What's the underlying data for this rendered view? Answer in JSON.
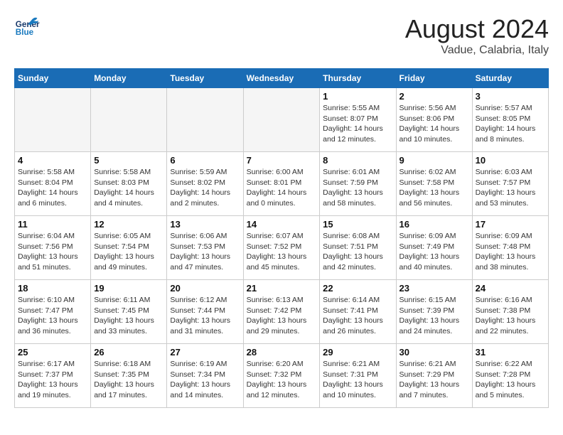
{
  "header": {
    "logo_general": "General",
    "logo_blue": "Blue",
    "month": "August 2024",
    "location": "Vadue, Calabria, Italy"
  },
  "days_of_week": [
    "Sunday",
    "Monday",
    "Tuesday",
    "Wednesday",
    "Thursday",
    "Friday",
    "Saturday"
  ],
  "weeks": [
    [
      {
        "day": "",
        "info": "",
        "empty": true
      },
      {
        "day": "",
        "info": "",
        "empty": true
      },
      {
        "day": "",
        "info": "",
        "empty": true
      },
      {
        "day": "",
        "info": "",
        "empty": true
      },
      {
        "day": "1",
        "info": "Sunrise: 5:55 AM\nSunset: 8:07 PM\nDaylight: 14 hours\nand 12 minutes."
      },
      {
        "day": "2",
        "info": "Sunrise: 5:56 AM\nSunset: 8:06 PM\nDaylight: 14 hours\nand 10 minutes."
      },
      {
        "day": "3",
        "info": "Sunrise: 5:57 AM\nSunset: 8:05 PM\nDaylight: 14 hours\nand 8 minutes."
      }
    ],
    [
      {
        "day": "4",
        "info": "Sunrise: 5:58 AM\nSunset: 8:04 PM\nDaylight: 14 hours\nand 6 minutes."
      },
      {
        "day": "5",
        "info": "Sunrise: 5:58 AM\nSunset: 8:03 PM\nDaylight: 14 hours\nand 4 minutes."
      },
      {
        "day": "6",
        "info": "Sunrise: 5:59 AM\nSunset: 8:02 PM\nDaylight: 14 hours\nand 2 minutes."
      },
      {
        "day": "7",
        "info": "Sunrise: 6:00 AM\nSunset: 8:01 PM\nDaylight: 14 hours\nand 0 minutes."
      },
      {
        "day": "8",
        "info": "Sunrise: 6:01 AM\nSunset: 7:59 PM\nDaylight: 13 hours\nand 58 minutes."
      },
      {
        "day": "9",
        "info": "Sunrise: 6:02 AM\nSunset: 7:58 PM\nDaylight: 13 hours\nand 56 minutes."
      },
      {
        "day": "10",
        "info": "Sunrise: 6:03 AM\nSunset: 7:57 PM\nDaylight: 13 hours\nand 53 minutes."
      }
    ],
    [
      {
        "day": "11",
        "info": "Sunrise: 6:04 AM\nSunset: 7:56 PM\nDaylight: 13 hours\nand 51 minutes."
      },
      {
        "day": "12",
        "info": "Sunrise: 6:05 AM\nSunset: 7:54 PM\nDaylight: 13 hours\nand 49 minutes."
      },
      {
        "day": "13",
        "info": "Sunrise: 6:06 AM\nSunset: 7:53 PM\nDaylight: 13 hours\nand 47 minutes."
      },
      {
        "day": "14",
        "info": "Sunrise: 6:07 AM\nSunset: 7:52 PM\nDaylight: 13 hours\nand 45 minutes."
      },
      {
        "day": "15",
        "info": "Sunrise: 6:08 AM\nSunset: 7:51 PM\nDaylight: 13 hours\nand 42 minutes."
      },
      {
        "day": "16",
        "info": "Sunrise: 6:09 AM\nSunset: 7:49 PM\nDaylight: 13 hours\nand 40 minutes."
      },
      {
        "day": "17",
        "info": "Sunrise: 6:09 AM\nSunset: 7:48 PM\nDaylight: 13 hours\nand 38 minutes."
      }
    ],
    [
      {
        "day": "18",
        "info": "Sunrise: 6:10 AM\nSunset: 7:47 PM\nDaylight: 13 hours\nand 36 minutes."
      },
      {
        "day": "19",
        "info": "Sunrise: 6:11 AM\nSunset: 7:45 PM\nDaylight: 13 hours\nand 33 minutes."
      },
      {
        "day": "20",
        "info": "Sunrise: 6:12 AM\nSunset: 7:44 PM\nDaylight: 13 hours\nand 31 minutes."
      },
      {
        "day": "21",
        "info": "Sunrise: 6:13 AM\nSunset: 7:42 PM\nDaylight: 13 hours\nand 29 minutes."
      },
      {
        "day": "22",
        "info": "Sunrise: 6:14 AM\nSunset: 7:41 PM\nDaylight: 13 hours\nand 26 minutes."
      },
      {
        "day": "23",
        "info": "Sunrise: 6:15 AM\nSunset: 7:39 PM\nDaylight: 13 hours\nand 24 minutes."
      },
      {
        "day": "24",
        "info": "Sunrise: 6:16 AM\nSunset: 7:38 PM\nDaylight: 13 hours\nand 22 minutes."
      }
    ],
    [
      {
        "day": "25",
        "info": "Sunrise: 6:17 AM\nSunset: 7:37 PM\nDaylight: 13 hours\nand 19 minutes."
      },
      {
        "day": "26",
        "info": "Sunrise: 6:18 AM\nSunset: 7:35 PM\nDaylight: 13 hours\nand 17 minutes."
      },
      {
        "day": "27",
        "info": "Sunrise: 6:19 AM\nSunset: 7:34 PM\nDaylight: 13 hours\nand 14 minutes."
      },
      {
        "day": "28",
        "info": "Sunrise: 6:20 AM\nSunset: 7:32 PM\nDaylight: 13 hours\nand 12 minutes."
      },
      {
        "day": "29",
        "info": "Sunrise: 6:21 AM\nSunset: 7:31 PM\nDaylight: 13 hours\nand 10 minutes."
      },
      {
        "day": "30",
        "info": "Sunrise: 6:21 AM\nSunset: 7:29 PM\nDaylight: 13 hours\nand 7 minutes."
      },
      {
        "day": "31",
        "info": "Sunrise: 6:22 AM\nSunset: 7:28 PM\nDaylight: 13 hours\nand 5 minutes."
      }
    ]
  ]
}
